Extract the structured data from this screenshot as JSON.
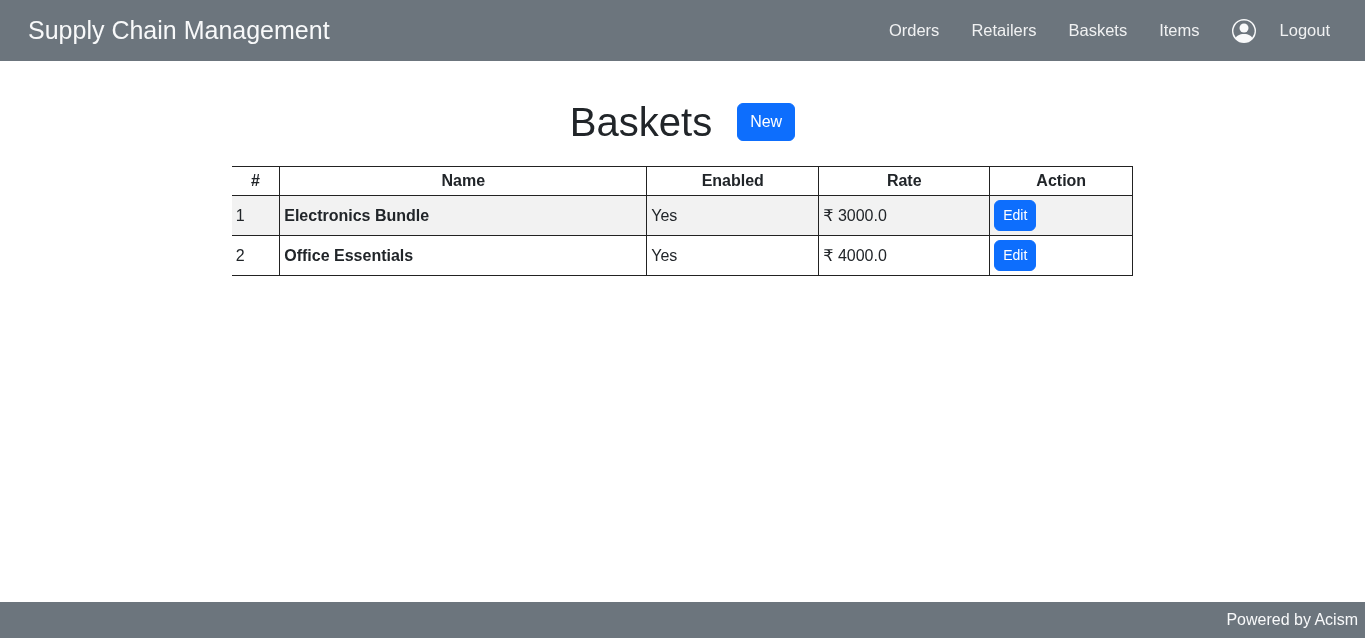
{
  "navbar": {
    "brand": "Supply Chain Management",
    "links": [
      "Orders",
      "Retailers",
      "Baskets",
      "Items"
    ],
    "logout": "Logout"
  },
  "heading": {
    "title": "Baskets",
    "button": "New"
  },
  "table": {
    "columns": [
      "#",
      "Name",
      "Enabled",
      "Rate",
      "Action"
    ],
    "rows": [
      {
        "number": "1",
        "name": "Electronics Bundle",
        "enabled": "Yes",
        "rate": "₹ 3000.0",
        "action": "Edit"
      },
      {
        "number": "2",
        "name": "Office Essentials",
        "enabled": "Yes",
        "rate": "₹ 4000.0",
        "action": "Edit"
      }
    ]
  },
  "footer": {
    "text": "Powered by Acism"
  }
}
